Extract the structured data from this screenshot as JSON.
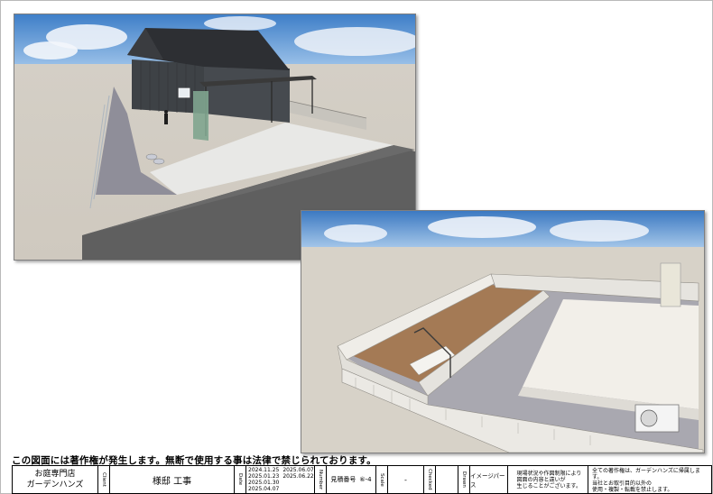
{
  "notice": "この図面には著作権が発生します。無断で使用する事は法律で禁じられております。",
  "company": {
    "line1": "お庭専門店",
    "line2": "ガーデンハンズ"
  },
  "title_block": {
    "client_label": "Client",
    "client": "様邸 工事",
    "date_label": "Date",
    "dates_col1": [
      "2024.11.25",
      "2025.01.23",
      "2025.01.30",
      "2025.04.07"
    ],
    "dates_col2": [
      "2025.06.07",
      "2025.06.22"
    ],
    "no_label": "Number",
    "estimate_label": "見積番号",
    "estimate_no": "⑥-4",
    "scale_label": "Scale",
    "scale_value": "-",
    "checked_label": "Checked",
    "drawn_label": "Drawn",
    "drawing_type": "イメージパース",
    "disclaimer": [
      "現場状況や作図制限により",
      "図面の内容と違いが",
      "生じることがございます。"
    ],
    "rights": [
      "全ての著作権は、ガーデンハンズに帰属します。",
      "当社とお取引目的以外の",
      "使用・複製・転載を禁止します。"
    ]
  },
  "colors": {
    "sky": "#4f8fd4",
    "ground": "#d9d4ca",
    "asphalt": "#5a5a5a",
    "soil": "#a47a55",
    "house": "#3e4246"
  }
}
